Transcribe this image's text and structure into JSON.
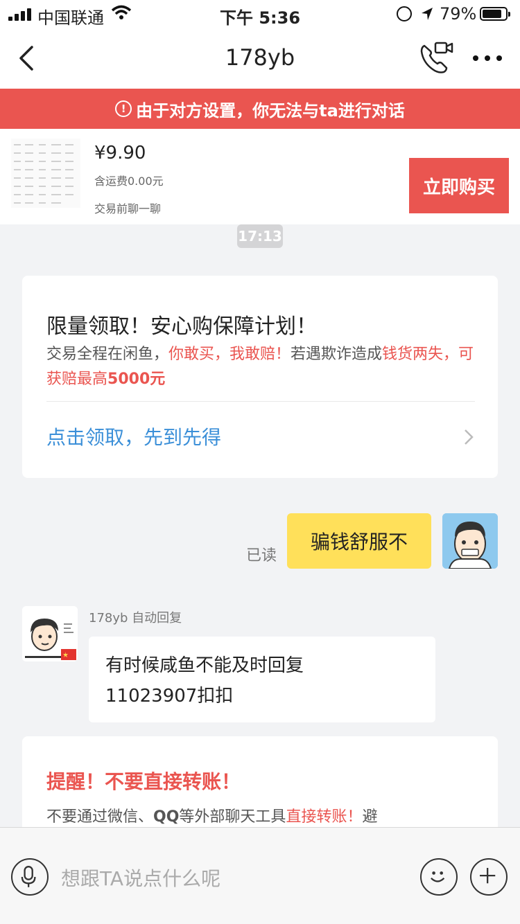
{
  "status_bar": {
    "carrier": "中国联通",
    "time": "下午 5:36",
    "battery_pct": "79%",
    "battery_level": 0.79
  },
  "nav": {
    "title": "178yb",
    "icons": [
      "back-icon",
      "video-call-icon",
      "more-icon"
    ]
  },
  "banner": {
    "alert_glyph": "!",
    "text": "由于对方设置，你无法与ta进行对话"
  },
  "product": {
    "price": "¥9.90",
    "shipping": "含运费0.00元",
    "chat_hint": "交易前聊一聊",
    "buy_label": "立即购买"
  },
  "timestamp": "17:13",
  "guarantee": {
    "title": "限量领取！安心购保障计划！",
    "body_1": "交易全程在闲鱼，",
    "body_2": "你敢买，我敢赔！",
    "body_3": "若遇欺诈造成",
    "body_4": "钱货两失，可获赔最高",
    "body_5": "5000元",
    "link": "点击领取，先到先得"
  },
  "my_message": {
    "read_status": "已读",
    "text": "骗钱舒服不"
  },
  "their_message": {
    "sender": "178yb 自动回复",
    "line_1": "有时候咸鱼不能及时回复",
    "line_2": "11023907扣扣"
  },
  "reminder": {
    "title": "提醒！不要直接转账！",
    "body_1": "不要通过微信、",
    "body_2": "QQ",
    "body_3": "等外部聊天工具",
    "body_4": "直接转账！",
    "body_5": "避"
  },
  "input": {
    "placeholder": "想跟TA说点什么呢"
  },
  "colors": {
    "accent_red": "#ea5550",
    "link_blue": "#3b8fd8",
    "my_bubble": "#ffe05a"
  }
}
